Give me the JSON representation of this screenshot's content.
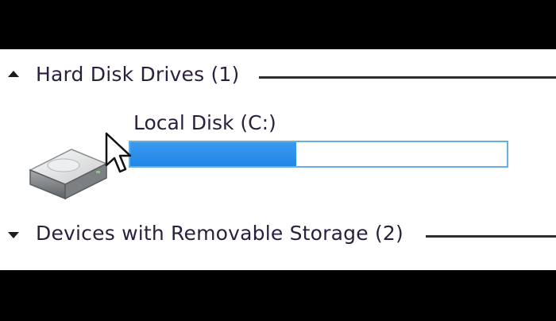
{
  "groups": {
    "hard_disk": {
      "title": "Hard Disk Drives (1)",
      "expanded": true
    },
    "removable": {
      "title": "Devices with Removable Storage (2)",
      "expanded": true
    }
  },
  "drives": [
    {
      "name": "Local Disk (C:)",
      "icon": "hard-drive-icon",
      "used_fraction": 0.44
    }
  ],
  "colors": {
    "usage_fill": "#2a8fea",
    "usage_border": "#6aaee0",
    "group_title": "#2b1f3d"
  }
}
